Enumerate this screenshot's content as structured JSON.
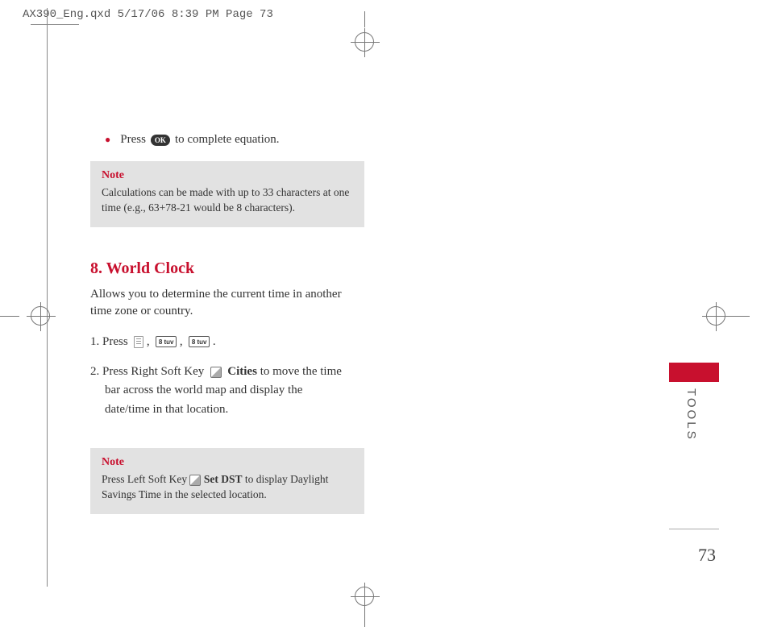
{
  "header": {
    "slug": "AX390_Eng.qxd  5/17/06  8:39 PM  Page 73"
  },
  "intro": {
    "bullet_pre": "Press",
    "ok": "OK",
    "bullet_post": "to complete equation."
  },
  "note1": {
    "title": "Note",
    "body": "Calculations can be made with up to 33 characters at one time (e.g., 63+78-21 would be 8 characters)."
  },
  "section": {
    "heading": "8. World Clock",
    "intro": "Allows you to determine the current time in another time zone or country.",
    "step1_lead": "1. Press",
    "key8": "8 tuv",
    "step2_lead": "2. Press Right Soft Key",
    "step2_bold": "Cities",
    "step2_tail": "to move the time bar across the world map and display the date/time in that location."
  },
  "note2": {
    "title": "Note",
    "body_pre": "Press Left Soft Key",
    "body_bold": "Set DST",
    "body_post": "to display Daylight Savings Time in the selected location."
  },
  "side": {
    "label": "TOOLS",
    "page": "73"
  }
}
